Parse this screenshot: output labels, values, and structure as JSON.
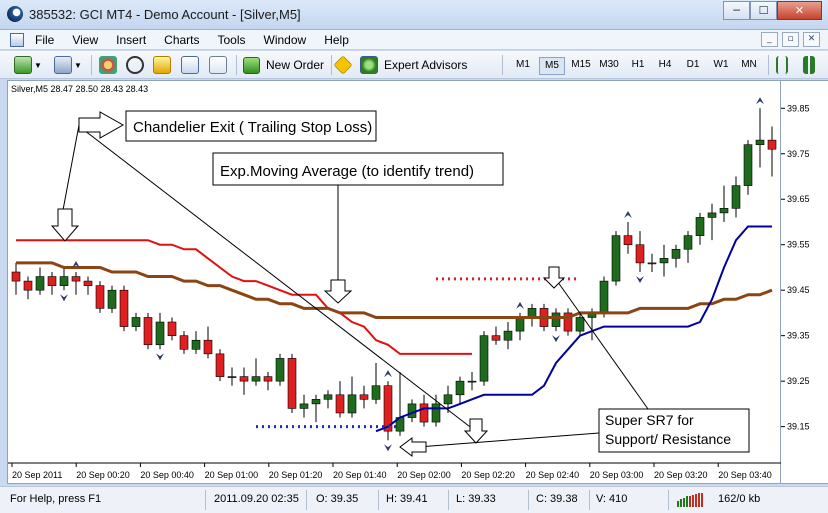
{
  "window": {
    "title": "385532: GCI MT4 - Demo Account - [Silver,M5]",
    "min_glyph": "─",
    "max_glyph": "☐",
    "close_glyph": "✕"
  },
  "menu": {
    "items": [
      "File",
      "View",
      "Insert",
      "Charts",
      "Tools",
      "Window",
      "Help"
    ],
    "mdi": [
      "_",
      "▫",
      "✕"
    ]
  },
  "toolbar": {
    "new_order": "New Order",
    "expert_advisors": "Expert Advisors",
    "timeframes": [
      "M1",
      "M5",
      "M15",
      "M30",
      "H1",
      "H4",
      "D1",
      "W1",
      "MN"
    ],
    "active_timeframe": "M5"
  },
  "chart": {
    "header": "Silver,M5  28.47 28.50 28.43 28.43",
    "annotations": {
      "chandelier": "Chandelier Exit ( Trailing Stop Loss)",
      "ema": "Exp.Moving Average (to identify trend)",
      "super_sr_line1": "Super SR7 for",
      "super_sr_line2": "Support/ Resistance"
    },
    "colors": {
      "bull": "#1e6b1e",
      "bear": "#e02020",
      "chandelier": "#e01010",
      "ema": "#8b4513",
      "super_sr": "#0000a0"
    }
  },
  "chart_data": {
    "type": "candlestick",
    "ylim": [
      39.07,
      39.91
    ],
    "y_ticks": [
      "39.85",
      "39.75",
      "39.65",
      "39.55",
      "39.45",
      "39.35",
      "39.25",
      "39.15"
    ],
    "x_ticks": [
      "20 Sep 2011",
      "20 Sep 00:20",
      "20 Sep 00:40",
      "20 Sep 01:00",
      "20 Sep 01:20",
      "20 Sep 01:40",
      "20 Sep 02:00",
      "20 Sep 02:20",
      "20 Sep 02:40",
      "20 Sep 03:00",
      "20 Sep 03:20",
      "20 Sep 03:40"
    ],
    "candles": [
      [
        39.49,
        39.51,
        39.44,
        39.47
      ],
      [
        39.47,
        39.48,
        39.43,
        39.45
      ],
      [
        39.45,
        39.5,
        39.44,
        39.48
      ],
      [
        39.48,
        39.49,
        39.44,
        39.46
      ],
      [
        39.46,
        39.5,
        39.45,
        39.48
      ],
      [
        39.48,
        39.49,
        39.44,
        39.47
      ],
      [
        39.47,
        39.48,
        39.44,
        39.46
      ],
      [
        39.46,
        39.47,
        39.4,
        39.41
      ],
      [
        39.41,
        39.46,
        39.4,
        39.45
      ],
      [
        39.45,
        39.46,
        39.36,
        39.37
      ],
      [
        39.37,
        39.4,
        39.36,
        39.39
      ],
      [
        39.39,
        39.4,
        39.32,
        39.33
      ],
      [
        39.33,
        39.4,
        39.32,
        39.38
      ],
      [
        39.38,
        39.39,
        39.34,
        39.35
      ],
      [
        39.35,
        39.36,
        39.31,
        39.32
      ],
      [
        39.32,
        39.36,
        39.31,
        39.34
      ],
      [
        39.34,
        39.37,
        39.3,
        39.31
      ],
      [
        39.31,
        39.32,
        39.25,
        39.26
      ],
      [
        39.26,
        39.28,
        39.24,
        39.26
      ],
      [
        39.26,
        39.28,
        39.22,
        39.25
      ],
      [
        39.25,
        39.3,
        39.24,
        39.26
      ],
      [
        39.26,
        39.27,
        39.23,
        39.25
      ],
      [
        39.25,
        39.31,
        39.24,
        39.3
      ],
      [
        39.3,
        39.31,
        39.18,
        39.19
      ],
      [
        39.19,
        39.22,
        39.17,
        39.2
      ],
      [
        39.2,
        39.22,
        39.16,
        39.21
      ],
      [
        39.21,
        39.23,
        39.19,
        39.22
      ],
      [
        39.22,
        39.25,
        39.17,
        39.18
      ],
      [
        39.18,
        39.26,
        39.17,
        39.22
      ],
      [
        39.22,
        39.24,
        39.19,
        39.21
      ],
      [
        39.21,
        39.29,
        39.2,
        39.24
      ],
      [
        39.24,
        39.25,
        39.12,
        39.14
      ],
      [
        39.14,
        39.27,
        39.13,
        39.17
      ],
      [
        39.17,
        39.21,
        39.16,
        39.2
      ],
      [
        39.2,
        39.22,
        39.15,
        39.16
      ],
      [
        39.16,
        39.22,
        39.15,
        39.2
      ],
      [
        39.2,
        39.24,
        39.18,
        39.22
      ],
      [
        39.22,
        39.26,
        39.2,
        39.25
      ],
      [
        39.25,
        39.27,
        39.23,
        39.25
      ],
      [
        39.25,
        39.36,
        39.24,
        39.35
      ],
      [
        39.35,
        39.37,
        39.33,
        39.34
      ],
      [
        39.34,
        39.38,
        39.32,
        39.36
      ],
      [
        39.36,
        39.4,
        39.34,
        39.39
      ],
      [
        39.39,
        39.42,
        39.37,
        39.41
      ],
      [
        39.41,
        39.42,
        39.36,
        39.37
      ],
      [
        39.37,
        39.41,
        39.36,
        39.4
      ],
      [
        39.4,
        39.41,
        39.35,
        39.36
      ],
      [
        39.36,
        39.4,
        39.35,
        39.39
      ],
      [
        39.39,
        39.41,
        39.34,
        39.4
      ],
      [
        39.4,
        39.48,
        39.39,
        39.47
      ],
      [
        39.47,
        39.58,
        39.46,
        39.57
      ],
      [
        39.57,
        39.6,
        39.53,
        39.55
      ],
      [
        39.55,
        39.58,
        39.49,
        39.51
      ],
      [
        39.51,
        39.53,
        39.49,
        39.51
      ],
      [
        39.51,
        39.55,
        39.48,
        39.52
      ],
      [
        39.52,
        39.55,
        39.5,
        39.54
      ],
      [
        39.54,
        39.58,
        39.51,
        39.57
      ],
      [
        39.57,
        39.62,
        39.55,
        39.61
      ],
      [
        39.61,
        39.64,
        39.56,
        39.62
      ],
      [
        39.62,
        39.68,
        39.6,
        39.63
      ],
      [
        39.63,
        39.7,
        39.61,
        39.68
      ],
      [
        39.68,
        39.78,
        39.66,
        39.77
      ],
      [
        39.77,
        39.85,
        39.72,
        39.78
      ],
      [
        39.78,
        39.81,
        39.7,
        39.76
      ]
    ],
    "chandelier_exit": [
      39.56,
      39.56,
      39.56,
      39.56,
      39.56,
      39.56,
      39.56,
      39.56,
      39.56,
      39.56,
      39.56,
      39.56,
      39.55,
      39.55,
      39.54,
      39.54,
      39.52,
      39.5,
      39.48,
      39.47,
      39.47,
      39.46,
      39.45,
      39.44,
      39.44,
      39.44,
      39.41,
      39.4,
      39.38,
      39.37,
      39.34,
      39.33,
      39.31,
      39.31,
      39.31,
      39.31,
      39.31,
      39.31,
      39.31
    ],
    "ema": [
      39.51,
      39.51,
      39.51,
      39.51,
      39.5,
      39.5,
      39.5,
      39.5,
      39.49,
      39.49,
      39.49,
      39.48,
      39.48,
      39.48,
      39.47,
      39.47,
      39.46,
      39.46,
      39.45,
      39.44,
      39.43,
      39.43,
      39.42,
      39.42,
      39.41,
      39.41,
      39.41,
      39.4,
      39.4,
      39.4,
      39.39,
      39.39,
      39.39,
      39.39,
      39.39,
      39.39,
      39.39,
      39.39,
      39.39,
      39.39,
      39.39,
      39.39,
      39.39,
      39.39,
      39.39,
      39.39,
      39.39,
      39.4,
      39.4,
      39.4,
      39.4,
      39.4,
      39.41,
      39.41,
      39.41,
      39.41,
      39.41,
      39.42,
      39.42,
      39.43,
      39.43,
      39.44,
      39.44,
      39.45
    ],
    "super_sr": [
      39.14,
      39.15,
      39.17,
      39.18,
      39.19,
      39.19,
      39.19,
      39.2,
      39.21,
      39.22,
      39.22,
      39.22,
      39.22,
      39.22,
      39.24,
      39.29,
      39.32,
      39.35,
      39.36,
      39.37,
      39.37,
      39.37,
      39.37,
      39.37,
      39.37,
      39.37,
      39.37,
      39.38,
      39.43,
      39.5,
      39.56,
      39.59,
      39.59,
      39.59
    ],
    "resistance_level": 39.475,
    "support_level": 39.15
  },
  "status": {
    "help": "For Help, press F1",
    "datetime": "2011.09.20 02:35",
    "open": "O: 39.35",
    "high": "H: 39.41",
    "low": "L: 39.33",
    "close": "C: 39.38",
    "volume": "V: 410",
    "traffic": "162/0 kb"
  }
}
